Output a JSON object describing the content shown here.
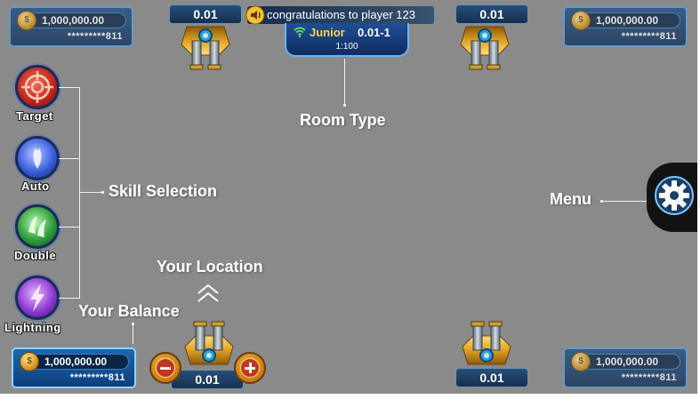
{
  "players": {
    "top_left": {
      "amount": "1,000,000.00",
      "account": "*********811"
    },
    "top_right": {
      "amount": "1,000,000.00",
      "account": "*********811"
    },
    "bottom_left": {
      "amount": "1,000,000.00",
      "account": "*********811"
    },
    "bottom_right": {
      "amount": "1,000,000.00",
      "account": "*********811"
    }
  },
  "bets": {
    "top_left": "0.01",
    "top_right": "0.01",
    "bottom_left": "0.01",
    "bottom_right": "0.01"
  },
  "announcement": {
    "text": "congratulations to player 123",
    "icon": "speaker-icon"
  },
  "room": {
    "name": "Junior",
    "bet_range": "0.01-1",
    "ratio": "1:100",
    "icon": "wifi-icon"
  },
  "skills": [
    {
      "label": "Target",
      "icon": "target-icon",
      "color": "#c6271f"
    },
    {
      "label": "Auto",
      "icon": "auto-icon",
      "color": "#3b5fe0"
    },
    {
      "label": "Double",
      "icon": "double-icon",
      "color": "#2e9e3e"
    },
    {
      "label": "Lightning",
      "icon": "lightning-icon",
      "color": "#8e3bd6"
    }
  ],
  "annotations": {
    "room_type": "Room Type",
    "skill_selection": "Skill Selection",
    "menu": "Menu",
    "your_location": "Your Location",
    "your_balance": "Your Balance"
  },
  "controls": {
    "minus_icon": "minus-icon",
    "plus_icon": "plus-icon",
    "menu_icon": "gear-icon"
  },
  "colors": {
    "background": "#8a8a8a",
    "panel": "#0e2f58",
    "room_gold": "#ffd24a",
    "menu_bg": "#121212"
  }
}
